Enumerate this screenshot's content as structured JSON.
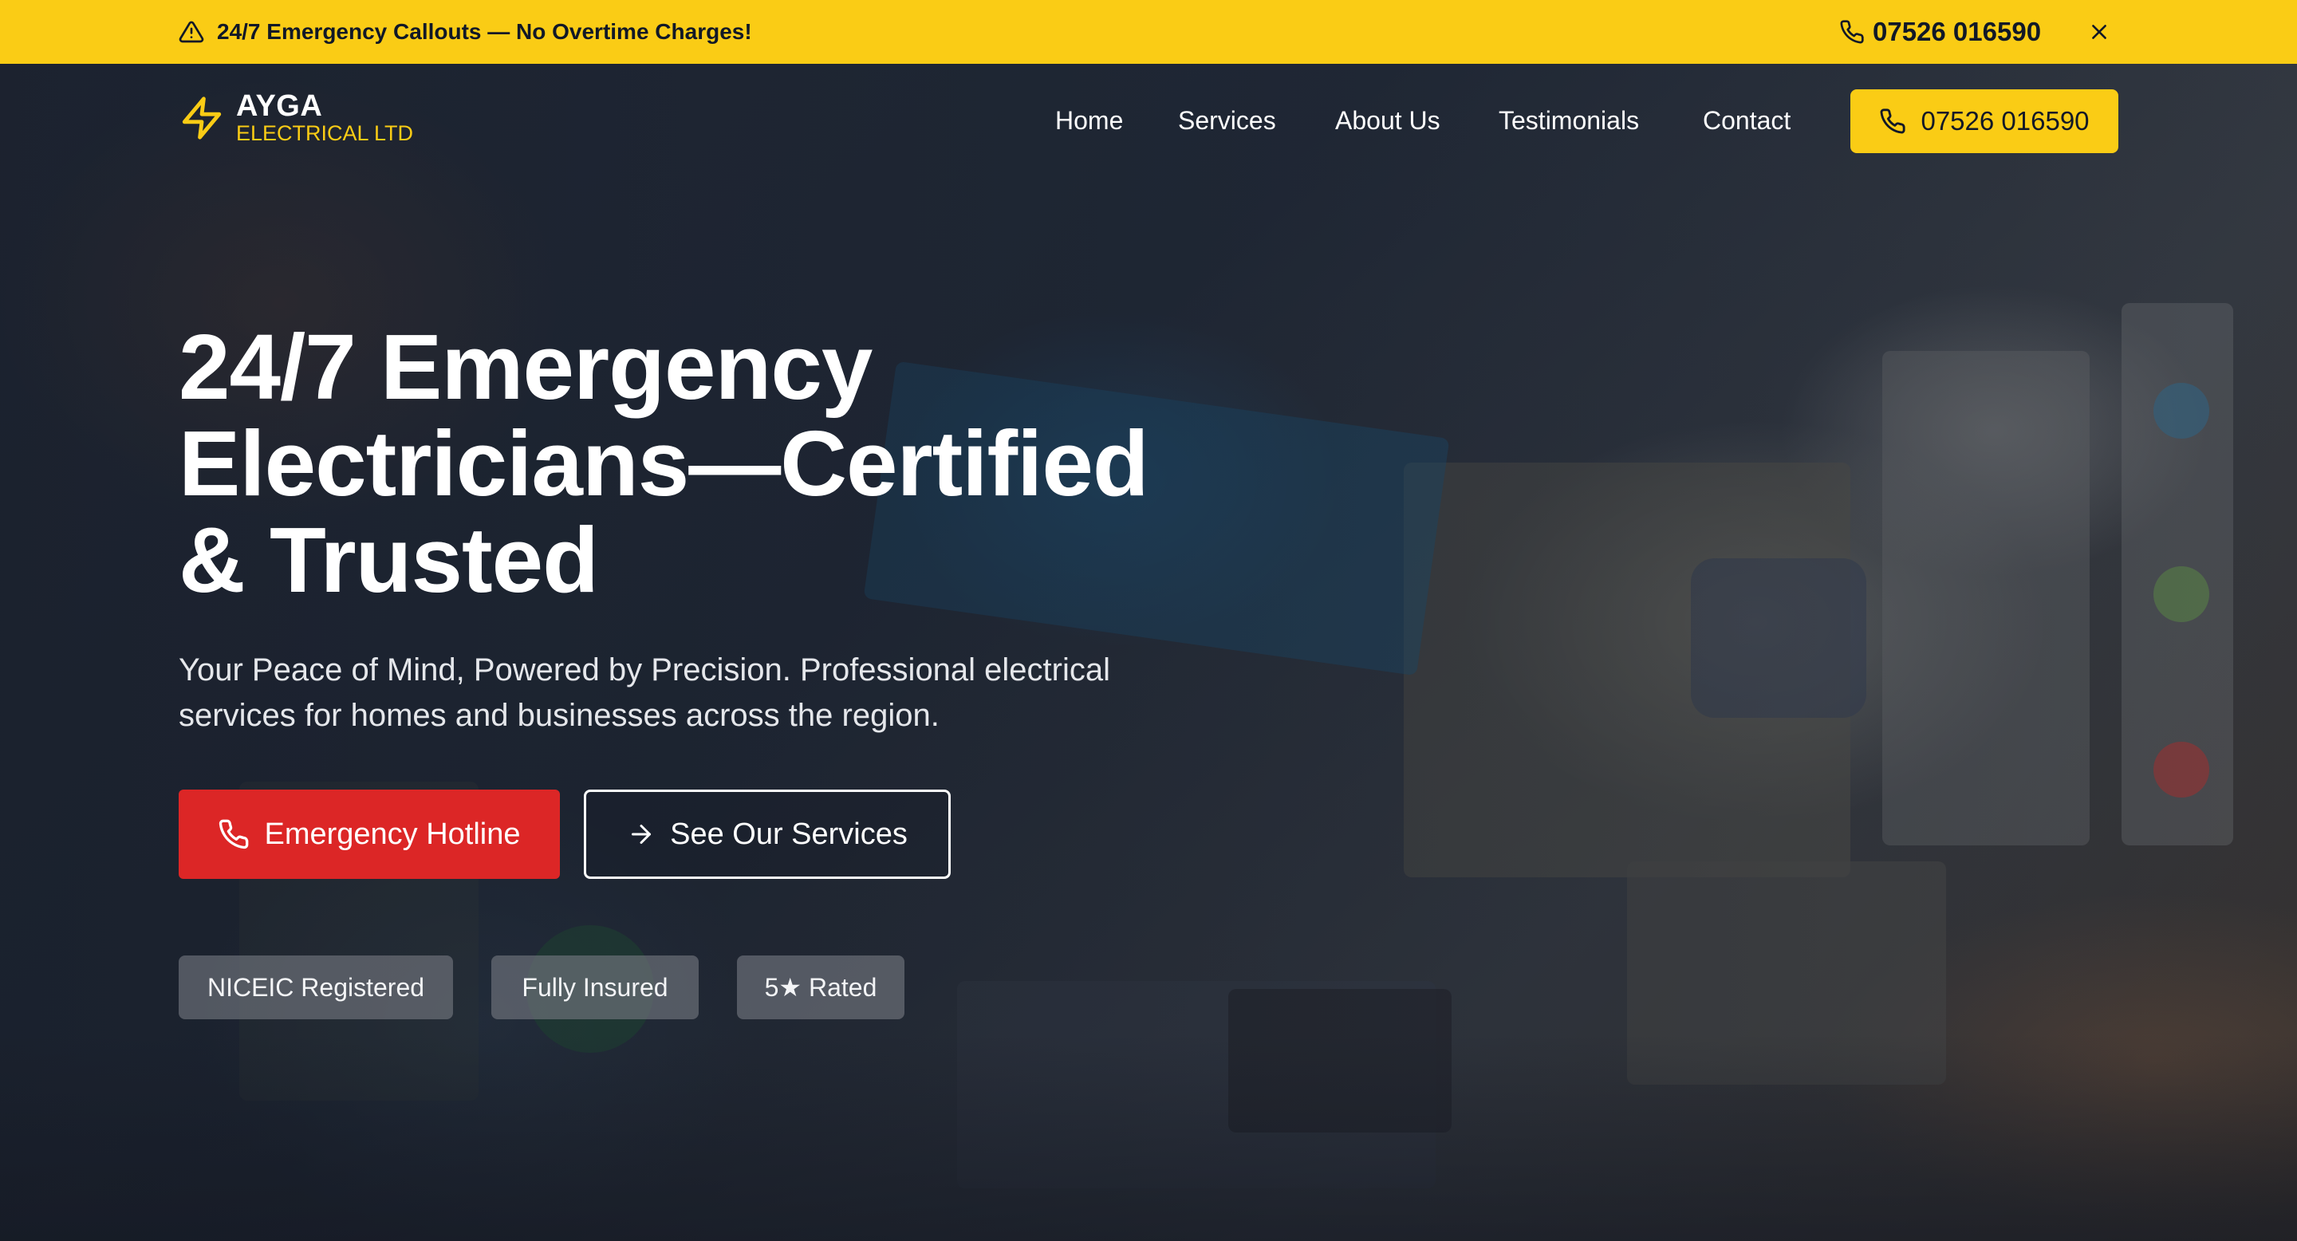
{
  "announcement": {
    "message": "24/7 Emergency Callouts — No Overtime Charges!",
    "phone": "07526 016590",
    "icon": "warning-triangle-icon",
    "close_icon": "close-icon"
  },
  "brand": {
    "name": "AYGA",
    "tagline": "ELECTRICAL LTD",
    "icon": "lightning-bolt-icon"
  },
  "nav": {
    "items": [
      {
        "label": "Home"
      },
      {
        "label": "Services"
      },
      {
        "label": "About Us"
      },
      {
        "label": "Testimonials"
      },
      {
        "label": "Contact"
      }
    ],
    "call_label": "07526 016590"
  },
  "hero": {
    "title_line1": "24/7 Emergency",
    "title_line2": "Electricians—Certified",
    "title_line3": "& Trusted",
    "subtitle_line1": "Your Peace of Mind, Powered by Precision. Professional electrical",
    "subtitle_line2": "services for homes and businesses across the region.",
    "primary_button": "Emergency Hotline",
    "secondary_button": "See Our Services",
    "badges": [
      "NICEIC Registered",
      "Fully Insured",
      "5★ Rated"
    ]
  },
  "colors": {
    "accent_yellow": "#FACC15",
    "emergency_red": "#DC2626",
    "text_dark": "#111827",
    "text_light": "#ffffff"
  }
}
